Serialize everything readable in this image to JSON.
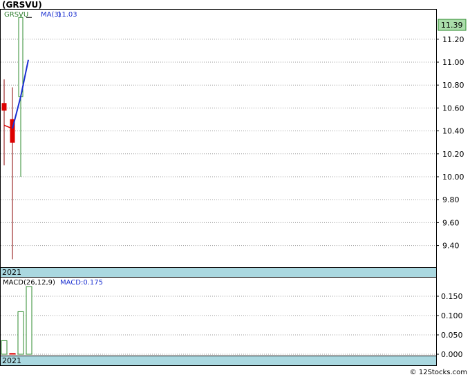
{
  "title": "(GRSVU)",
  "footer": "© 12Stocks.com",
  "chart_data": [
    {
      "type": "candlestick",
      "legend": {
        "symbol": "GRSVU",
        "ma_label": "MA(3)",
        "ma_value": "11.03"
      },
      "year_label": "2021",
      "last_price_label": "11.39",
      "y_ticks": [
        "11.20",
        "11.00",
        "10.80",
        "10.60",
        "10.40",
        "10.20",
        "10.00",
        "9.80",
        "9.60",
        "9.40"
      ],
      "ylim": [
        9.25,
        11.5
      ],
      "candles": [
        {
          "open": 10.64,
          "high": 10.85,
          "low": 10.1,
          "close": 10.58,
          "color": "red"
        },
        {
          "open": 10.5,
          "high": 10.78,
          "low": 9.28,
          "close": 10.3,
          "color": "red"
        },
        {
          "open": 10.7,
          "high": 11.4,
          "low": 10.0,
          "close": 11.39,
          "color": "green"
        }
      ],
      "ma": [
        10.45,
        10.42,
        11.03
      ],
      "ma_trend_end": 11.02,
      "colors": {
        "up": "#2e8b2e",
        "down": "#dd0000",
        "ma": "#1a2fd0",
        "label_bg": "#aad8e0",
        "price_bg": "#aaddaa"
      }
    },
    {
      "type": "bar",
      "legend": {
        "label": "MACD(26,12,9)",
        "value_label": "MACD:0.175"
      },
      "year_label": "2021",
      "y_ticks": [
        "0.150",
        "0.100",
        "0.050",
        "0.000"
      ],
      "ylim": [
        -0.005,
        0.19
      ],
      "values": [
        0.035,
        0.002,
        0.11,
        0.175
      ],
      "colors": [
        "green",
        "red",
        "green",
        "green"
      ]
    }
  ]
}
